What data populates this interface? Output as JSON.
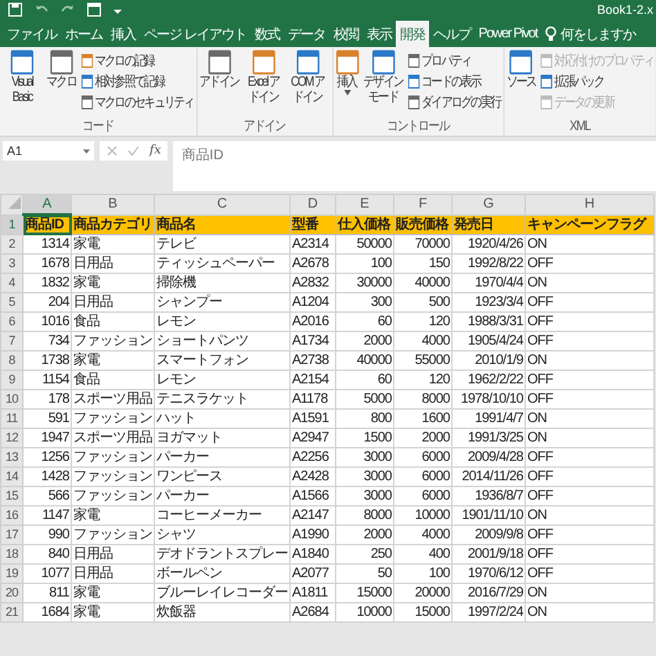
{
  "title_bar": {
    "title": "Book1-2.x"
  },
  "tabs": [
    {
      "label": "ファイル",
      "selected": false
    },
    {
      "label": "ホーム",
      "selected": false
    },
    {
      "label": "挿入",
      "selected": false
    },
    {
      "label": "ページ レイアウト",
      "selected": false
    },
    {
      "label": "数式",
      "selected": false
    },
    {
      "label": "データ",
      "selected": false
    },
    {
      "label": "校閲",
      "selected": false
    },
    {
      "label": "表示",
      "selected": false
    },
    {
      "label": "開発",
      "selected": true
    },
    {
      "label": "ヘルプ",
      "selected": false
    },
    {
      "label": "Power Pivot",
      "selected": false
    }
  ],
  "tell_me": "何をしますか",
  "ribbon_groups": [
    {
      "label": "コード",
      "items": [
        {
          "kind": "large",
          "label": "Visual Basic",
          "disabled": false
        },
        {
          "kind": "large",
          "label": "マクロ",
          "disabled": false
        },
        {
          "kind": "small",
          "label": "マクロの記録",
          "disabled": false
        },
        {
          "kind": "small",
          "label": "相対参照で記録",
          "disabled": false
        },
        {
          "kind": "small",
          "label": "マクロのセキュリティ",
          "disabled": false
        }
      ]
    },
    {
      "label": "アドイン",
      "items": [
        {
          "kind": "large",
          "label": "アドイン",
          "disabled": false
        },
        {
          "kind": "large",
          "label": "Excel アドイン",
          "disabled": false
        },
        {
          "kind": "large",
          "label": "COM アドイン",
          "disabled": false
        }
      ]
    },
    {
      "label": "コントロール",
      "items": [
        {
          "kind": "dropdown",
          "label": "挿入",
          "disabled": false
        },
        {
          "kind": "large",
          "label": "デザインモード",
          "disabled": false
        },
        {
          "kind": "small",
          "label": "プロパティ",
          "disabled": false
        },
        {
          "kind": "small",
          "label": "コードの表示",
          "disabled": false
        },
        {
          "kind": "small",
          "label": "ダイアログの実行",
          "disabled": false
        }
      ]
    },
    {
      "label": "XML",
      "items": [
        {
          "kind": "large",
          "label": "ソース",
          "disabled": false
        },
        {
          "kind": "small",
          "label": "対応付けのプロパティ",
          "disabled": true
        },
        {
          "kind": "small",
          "label": "拡張パック",
          "disabled": false
        },
        {
          "kind": "small",
          "label": "データの更新",
          "disabled": true
        }
      ]
    }
  ],
  "formula_bar": {
    "name_box": "A1",
    "function_label": "fx",
    "formula": "商品ID"
  },
  "columns": [
    {
      "label": "A",
      "selected": true
    },
    {
      "label": "B",
      "selected": false
    },
    {
      "label": "C",
      "selected": false
    },
    {
      "label": "D",
      "selected": false
    },
    {
      "label": "E",
      "selected": false
    },
    {
      "label": "F",
      "selected": false
    },
    {
      "label": "G",
      "selected": false
    },
    {
      "label": "H",
      "selected": false
    }
  ],
  "rows": [
    {
      "number": "1",
      "selected": true,
      "kind": "header",
      "cells": [
        "商品ID",
        "商品カテゴリ",
        "商品名",
        "型番",
        "仕入価格",
        "販売価格",
        "発売日",
        "キャンペーンフラグ"
      ]
    },
    {
      "number": "2",
      "selected": false,
      "kind": "data",
      "cells": [
        "1314",
        "家電",
        "テレビ",
        "A2314",
        "50000",
        "70000",
        "1920/4/26",
        "ON"
      ]
    },
    {
      "number": "3",
      "selected": false,
      "kind": "data",
      "cells": [
        "1678",
        "日用品",
        "ティッシュペーパー",
        "A2678",
        "100",
        "150",
        "1992/8/22",
        "OFF"
      ]
    },
    {
      "number": "4",
      "selected": false,
      "kind": "data",
      "cells": [
        "1832",
        "家電",
        "掃除機",
        "A2832",
        "30000",
        "40000",
        "1970/4/4",
        "ON"
      ]
    },
    {
      "number": "5",
      "selected": false,
      "kind": "data",
      "cells": [
        "204",
        "日用品",
        "シャンプー",
        "A1204",
        "300",
        "500",
        "1923/3/4",
        "OFF"
      ]
    },
    {
      "number": "6",
      "selected": false,
      "kind": "data",
      "cells": [
        "1016",
        "食品",
        "レモン",
        "A2016",
        "60",
        "120",
        "1988/3/31",
        "OFF"
      ]
    },
    {
      "number": "7",
      "selected": false,
      "kind": "data",
      "cells": [
        "734",
        "ファッション",
        "ショートパンツ",
        "A1734",
        "2000",
        "4000",
        "1905/4/24",
        "OFF"
      ]
    },
    {
      "number": "8",
      "selected": false,
      "kind": "data",
      "cells": [
        "1738",
        "家電",
        "スマートフォン",
        "A2738",
        "40000",
        "55000",
        "2010/1/9",
        "ON"
      ]
    },
    {
      "number": "9",
      "selected": false,
      "kind": "data",
      "cells": [
        "1154",
        "食品",
        "レモン",
        "A2154",
        "60",
        "120",
        "1962/2/22",
        "OFF"
      ]
    },
    {
      "number": "10",
      "selected": false,
      "kind": "data",
      "cells": [
        "178",
        "スポーツ用品",
        "テニスラケット",
        "A1178",
        "5000",
        "8000",
        "1978/10/10",
        "OFF"
      ]
    },
    {
      "number": "11",
      "selected": false,
      "kind": "data",
      "cells": [
        "591",
        "ファッション",
        "ハット",
        "A1591",
        "800",
        "1600",
        "1991/4/7",
        "ON"
      ]
    },
    {
      "number": "12",
      "selected": false,
      "kind": "data",
      "cells": [
        "1947",
        "スポーツ用品",
        "ヨガマット",
        "A2947",
        "1500",
        "2000",
        "1991/3/25",
        "ON"
      ]
    },
    {
      "number": "13",
      "selected": false,
      "kind": "data",
      "cells": [
        "1256",
        "ファッション",
        "パーカー",
        "A2256",
        "3000",
        "6000",
        "2009/4/28",
        "OFF"
      ]
    },
    {
      "number": "14",
      "selected": false,
      "kind": "data",
      "cells": [
        "1428",
        "ファッション",
        "ワンピース",
        "A2428",
        "3000",
        "6000",
        "2014/11/26",
        "OFF"
      ]
    },
    {
      "number": "15",
      "selected": false,
      "kind": "data",
      "cells": [
        "566",
        "ファッション",
        "パーカー",
        "A1566",
        "3000",
        "6000",
        "1936/8/7",
        "OFF"
      ]
    },
    {
      "number": "16",
      "selected": false,
      "kind": "data",
      "cells": [
        "1147",
        "家電",
        "コーヒーメーカー",
        "A2147",
        "8000",
        "10000",
        "1901/11/10",
        "ON"
      ]
    },
    {
      "number": "17",
      "selected": false,
      "kind": "data",
      "cells": [
        "990",
        "ファッション",
        "シャツ",
        "A1990",
        "2000",
        "4000",
        "2009/9/8",
        "OFF"
      ]
    },
    {
      "number": "18",
      "selected": false,
      "kind": "data",
      "cells": [
        "840",
        "日用品",
        "デオドラントスプレー",
        "A1840",
        "250",
        "400",
        "2001/9/18",
        "OFF"
      ]
    },
    {
      "number": "19",
      "selected": false,
      "kind": "data",
      "cells": [
        "1077",
        "日用品",
        "ボールペン",
        "A2077",
        "50",
        "100",
        "1970/6/12",
        "OFF"
      ]
    },
    {
      "number": "20",
      "selected": false,
      "kind": "data",
      "cells": [
        "811",
        "家電",
        "ブルーレイレコーダー",
        "A1811",
        "15000",
        "20000",
        "2016/7/29",
        "ON"
      ]
    },
    {
      "number": "21",
      "selected": false,
      "kind": "data",
      "cells": [
        "1684",
        "家電",
        "炊飯器",
        "A2684",
        "10000",
        "15000",
        "1997/2/24",
        "ON"
      ]
    }
  ]
}
